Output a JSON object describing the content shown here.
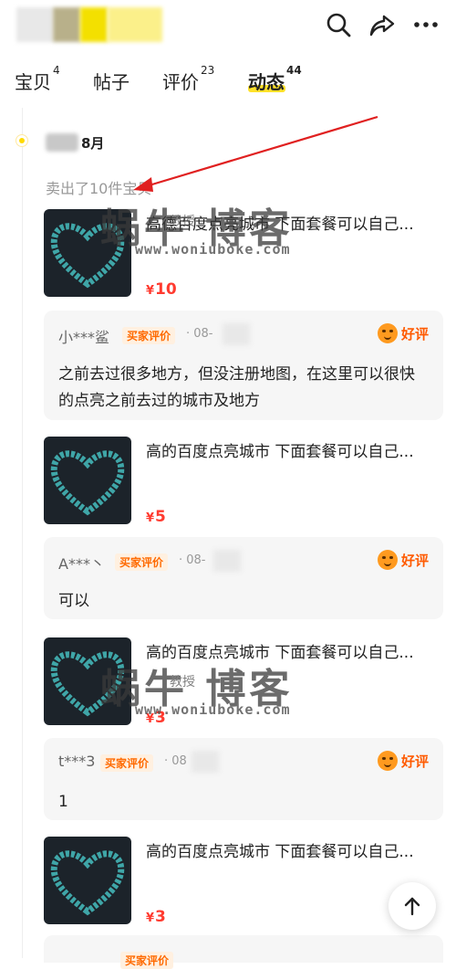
{
  "tabs": [
    {
      "label": "宝贝",
      "count": "4"
    },
    {
      "label": "帖子",
      "count": ""
    },
    {
      "label": "评价",
      "count": "23"
    },
    {
      "label": "动态",
      "count": "44",
      "active": true
    }
  ],
  "accent_color": "#ffe22a",
  "price_color": "#ff3b30",
  "icons": {
    "search": "search-icon",
    "share": "share-icon",
    "more": "more-icon",
    "scroll_top": "arrow-up-icon"
  },
  "timeline": {
    "date": "8月",
    "summary": "卖出了10件宝贝"
  },
  "watermark": {
    "brand": "蜗牛 博客",
    "sub": "教授",
    "url": "www.woniuboke.com"
  },
  "items": [
    {
      "title": "高德百度点亮城市 下面套餐可以自己...",
      "price": "10",
      "review": {
        "user": "小***鲨",
        "tag": "买家评价",
        "date": "· 08-",
        "rating": "好评",
        "text": "之前去过很多地方，但没注册地图，在这里可以很快的点亮之前去过的城市及地方"
      }
    },
    {
      "title": "高的百度点亮城市 下面套餐可以自己...",
      "price": "5",
      "review": {
        "user": "A***丶",
        "tag": "买家评价",
        "date": "· 08-",
        "rating": "好评",
        "text": "可以"
      }
    },
    {
      "title": "高的百度点亮城市 下面套餐可以自己...",
      "price": "3",
      "review": {
        "user": "t***3",
        "tag": "买家评价",
        "date": "· 08",
        "rating": "好评",
        "text": "1"
      }
    },
    {
      "title": "高的百度点亮城市 下面套餐可以自己...",
      "price": "3"
    }
  ],
  "bottom_peek": {
    "tag": "买家评价"
  },
  "yen": "¥"
}
